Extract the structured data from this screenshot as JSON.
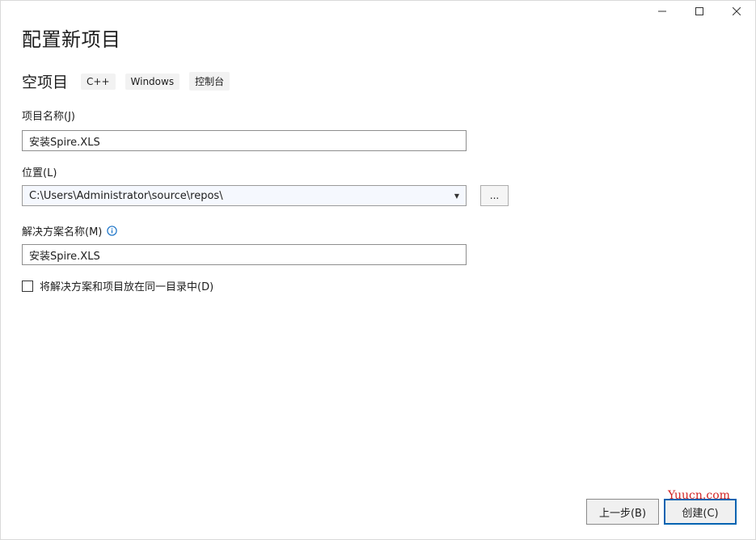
{
  "window": {
    "controls": {
      "minimize_icon": "minimize-icon",
      "maximize_icon": "maximize-icon",
      "close_icon": "close-icon"
    }
  },
  "page": {
    "title": "配置新项目"
  },
  "template": {
    "name": "空项目",
    "tags": [
      "C++",
      "Windows",
      "控制台"
    ]
  },
  "project_name": {
    "label": "项目名称(J)",
    "value": "安装Spire.XLS"
  },
  "location": {
    "label": "位置(L)",
    "value": "C:\\Users\\Administrator\\source\\repos\\",
    "browse_label": "..."
  },
  "solution_name": {
    "label": "解决方案名称(M)",
    "value": "安装Spire.XLS",
    "info_icon": "info-icon"
  },
  "same_dir": {
    "label": "将解决方案和项目放在同一目录中(D)",
    "checked": false
  },
  "footer": {
    "back_label": "上一步(B)",
    "create_label": "创建(C)"
  },
  "watermark": {
    "text": "Yuucn.com"
  },
  "colors": {
    "accent": "#0063b1",
    "info": "#1a73c7",
    "watermark": "#d22424"
  }
}
